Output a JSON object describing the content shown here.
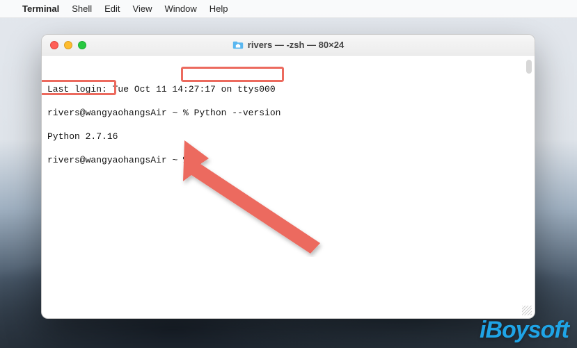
{
  "menubar": {
    "app_name": "Terminal",
    "items": [
      "Shell",
      "Edit",
      "View",
      "Window",
      "Help"
    ]
  },
  "window": {
    "title": "rivers — -zsh — 80×24"
  },
  "terminal": {
    "last_login_prefix": "Last login: Tue Oct 11 14:",
    "last_login_suffix_obscured": "27:17 on ttys000",
    "prompt_user_host": "rivers@wangyaohangsAir",
    "prompt_symbol": " ~ % ",
    "command": "Python --version",
    "output": "Python 2.7.16"
  },
  "annotation": {
    "highlight_color": "#ec6a5e"
  },
  "watermark": "iBoysoft"
}
